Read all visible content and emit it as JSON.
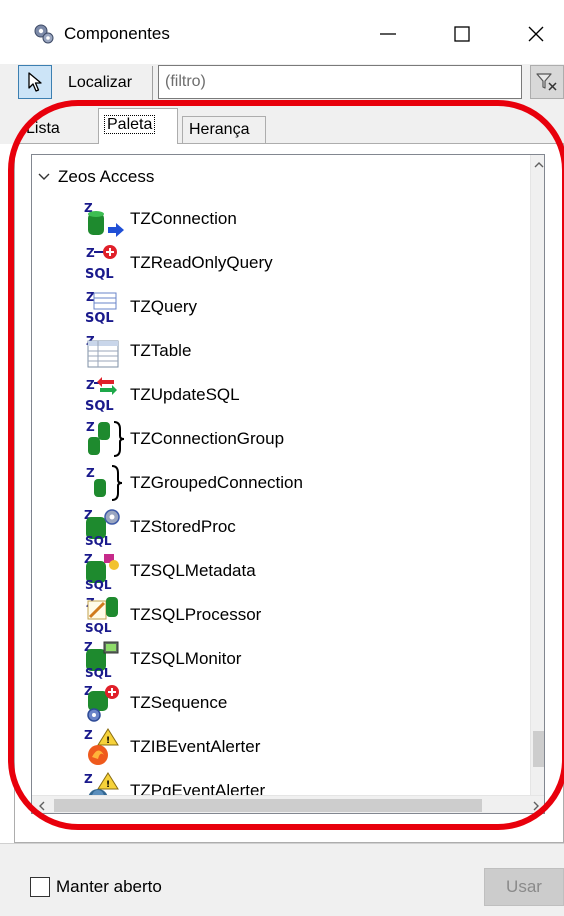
{
  "window": {
    "title": "Componentes",
    "app_icon": "gear-components-icon"
  },
  "toolbar": {
    "find_label": "Localizar",
    "filter_placeholder": "(filtro)",
    "filter_value": ""
  },
  "tabs": [
    {
      "label": "Lista",
      "selected": false
    },
    {
      "label": "Paleta",
      "selected": true
    },
    {
      "label": "Herança",
      "selected": false
    }
  ],
  "palette": {
    "group": "Zeos Access",
    "expanded": true,
    "items": [
      {
        "label": "TZConnection",
        "icon": "zeos-connection-icon"
      },
      {
        "label": "TZReadOnlyQuery",
        "icon": "zeos-readonly-query-icon"
      },
      {
        "label": "TZQuery",
        "icon": "zeos-query-icon"
      },
      {
        "label": "TZTable",
        "icon": "zeos-table-icon"
      },
      {
        "label": "TZUpdateSQL",
        "icon": "zeos-update-sql-icon"
      },
      {
        "label": "TZConnectionGroup",
        "icon": "zeos-connection-group-icon"
      },
      {
        "label": "TZGroupedConnection",
        "icon": "zeos-grouped-connection-icon"
      },
      {
        "label": "TZStoredProc",
        "icon": "zeos-stored-proc-icon"
      },
      {
        "label": "TZSQLMetadata",
        "icon": "zeos-sql-metadata-icon"
      },
      {
        "label": "TZSQLProcessor",
        "icon": "zeos-sql-processor-icon"
      },
      {
        "label": "TZSQLMonitor",
        "icon": "zeos-sql-monitor-icon"
      },
      {
        "label": "TZSequence",
        "icon": "zeos-sequence-icon"
      },
      {
        "label": "TZIBEventAlerter",
        "icon": "zeos-ib-event-alerter-icon"
      },
      {
        "label": "TZPgEventAlerter",
        "icon": "zeos-pg-event-alerter-icon"
      }
    ]
  },
  "footer": {
    "keep_open_label": "Manter aberto",
    "keep_open_checked": false,
    "use_label": "Usar",
    "use_enabled": false
  },
  "colors": {
    "annotation_ring": "#e8000c",
    "selected_tool": "#cce4f7"
  }
}
